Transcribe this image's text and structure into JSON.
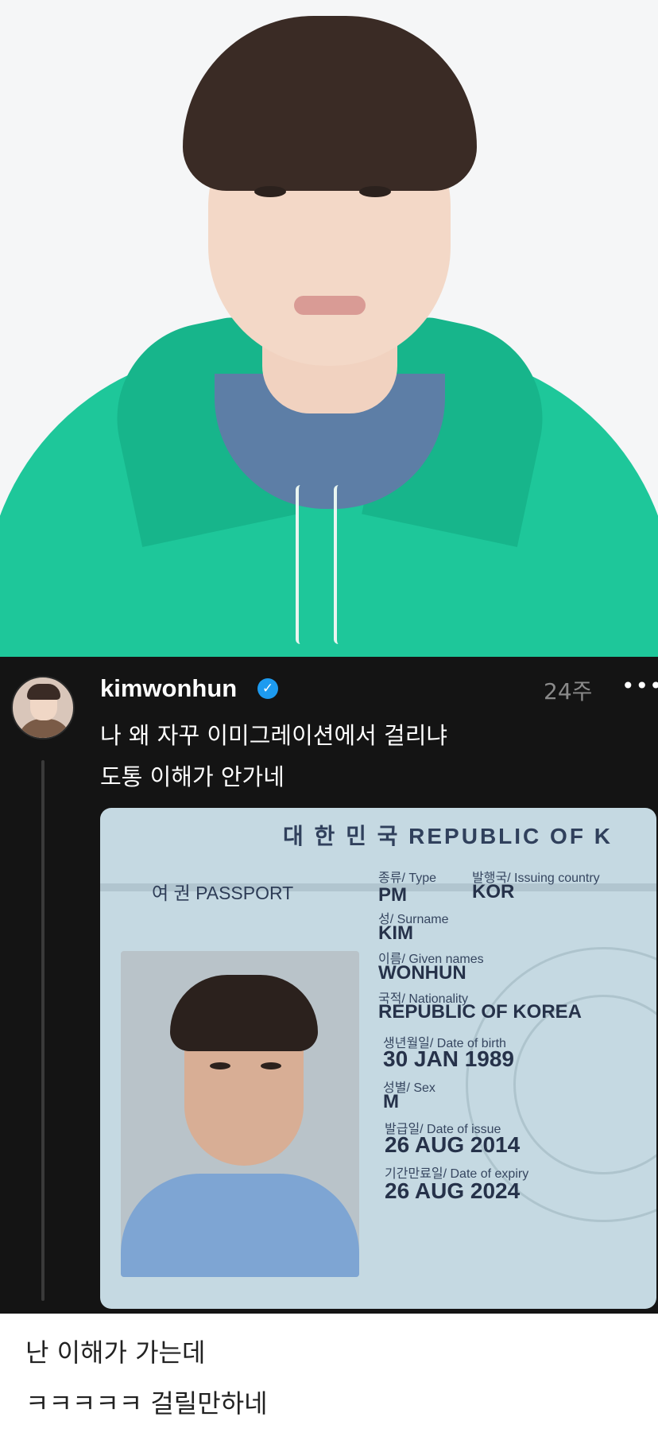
{
  "post": {
    "username": "kimwonhun",
    "time": "24주",
    "more": "•••",
    "text_line1": "나 왜 자꾸 이미그레이션에서 걸리냐",
    "text_line2": "도통 이해가 안가네"
  },
  "passport": {
    "header": "대 한 민 국   REPUBLIC OF K",
    "title": "여 권  PASSPORT",
    "type_label": "종류/ Type",
    "type_value": "PM",
    "country_label": "발행국/ Issuing country",
    "country_value": "KOR",
    "surname_label": "성/ Surname",
    "surname_value": "KIM",
    "given_label": "이름/ Given names",
    "given_value": "WONHUN",
    "nationality_label": "국적/ Nationality",
    "nationality_value": "REPUBLIC OF KOREA",
    "dob_label": "생년월일/ Date of birth",
    "dob_value": "30 JAN 1989",
    "sex_label": "성별/ Sex",
    "sex_value": "M",
    "issue_label": "발급일/ Date of issue",
    "issue_value": "26 AUG 2014",
    "expiry_label": "기간만료일/ Date of expiry",
    "expiry_value": "26 AUG 2024"
  },
  "comment": {
    "line1": "난 이해가 가는데",
    "line2": "ㅋㅋㅋㅋㅋ 걸릴만하네"
  }
}
